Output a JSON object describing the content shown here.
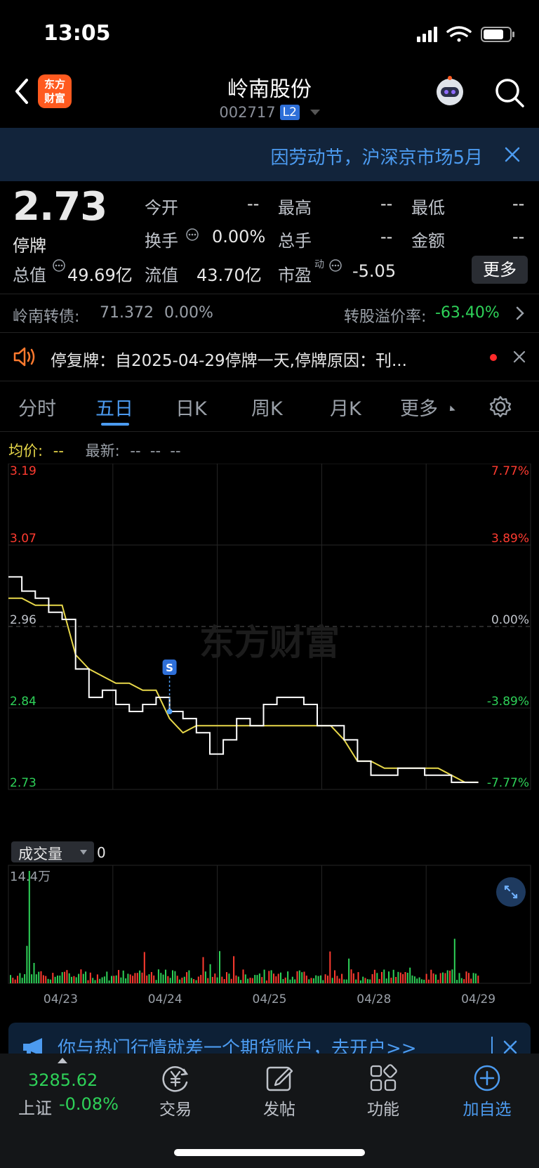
{
  "status": {
    "time": "13:05"
  },
  "header": {
    "title": "岭南股份",
    "code": "002717",
    "level": "L2",
    "brand_lines": [
      "东方",
      "财富"
    ]
  },
  "banner": {
    "text": "因劳动节，沪深京市场5月"
  },
  "quote": {
    "price": "2.73",
    "state": "停牌",
    "open_label": "今开",
    "open_val": "--",
    "high_label": "最高",
    "high_val": "--",
    "low_label": "最低",
    "low_val": "--",
    "turnover_label": "换手",
    "turnover_val": "0.00%",
    "volume_label": "总手",
    "volume_val": "--",
    "amount_label": "金额",
    "amount_val": "--",
    "mktcap_label": "总值",
    "mktcap_val": "49.69亿",
    "float_label": "流值",
    "float_val": "43.70亿",
    "pe_label": "市盈",
    "pe_sup": "动",
    "pe_val": "-5.05",
    "more_label": "更多"
  },
  "bond": {
    "label": "岭南转债:",
    "price": "71.372",
    "change": "0.00%",
    "premium_label": "转股溢价率:",
    "premium_val": "-63.40%"
  },
  "notice": {
    "text": "停复牌：自2025-04-29停牌一天,停牌原因：刊..."
  },
  "tabs": [
    "分时",
    "五日",
    "日K",
    "周K",
    "月K",
    "更多"
  ],
  "legend": {
    "avg_label": "均价:",
    "avg_val": "--",
    "latest_label": "最新:",
    "latest_vals": "--  --  --"
  },
  "watermark": "东方财富",
  "volume_panel": {
    "label": "成交量",
    "value": "0",
    "max_label": "14.4万"
  },
  "ad": {
    "text": "你与热门行情就差一个期货账户，去开户>>"
  },
  "bottom_bar": {
    "index_value": "3285.62",
    "index_name": "上证",
    "index_change": "-0.08%",
    "tabs": [
      {
        "label": "交易",
        "icon": "yen-icon"
      },
      {
        "label": "发帖",
        "icon": "edit-icon"
      },
      {
        "label": "功能",
        "icon": "grid-icon"
      },
      {
        "label": "加自选",
        "icon": "plus-circle-icon"
      }
    ]
  },
  "colors": {
    "up": "#ff3b30",
    "down": "#2ed158",
    "accent": "#4c9bf0",
    "avg_line": "#e8d84a"
  },
  "chart_data": {
    "type": "line",
    "title": "",
    "categories": [
      "04/23",
      "04/24",
      "04/25",
      "04/28",
      "04/29"
    ],
    "y_ticks_left": [
      "3.19",
      "3.07",
      "2.96",
      "2.84",
      "2.73"
    ],
    "y_ticks_right": [
      "7.77%",
      "3.89%",
      "0.00%",
      "-3.89%",
      "-7.77%"
    ],
    "ylim": [
      2.73,
      3.19
    ],
    "prev_close": 2.96,
    "series": [
      {
        "role": "price",
        "values": [
          3.03,
          3.01,
          3.0,
          2.98,
          2.97,
          2.9,
          2.86,
          2.87,
          2.85,
          2.84,
          2.85,
          2.86,
          2.84,
          2.83,
          2.81,
          2.78,
          2.8,
          2.83,
          2.82,
          2.85,
          2.86,
          2.86,
          2.85,
          2.82,
          2.82,
          2.8,
          2.77,
          2.75,
          2.75,
          2.76,
          2.76,
          2.75,
          2.75,
          2.74,
          2.74,
          2.74
        ]
      },
      {
        "role": "avg",
        "values": [
          3.0,
          3.0,
          2.99,
          2.99,
          2.99,
          2.92,
          2.9,
          2.89,
          2.88,
          2.88,
          2.87,
          2.87,
          2.83,
          2.81,
          2.82,
          2.82,
          2.82,
          2.82,
          2.82,
          2.82,
          2.82,
          2.82,
          2.82,
          2.82,
          2.82,
          2.8,
          2.77,
          2.77,
          2.76,
          2.76,
          2.76,
          2.76,
          2.76,
          2.75,
          2.74,
          2.74
        ]
      }
    ],
    "markers": [
      {
        "label": "S"
      }
    ]
  }
}
